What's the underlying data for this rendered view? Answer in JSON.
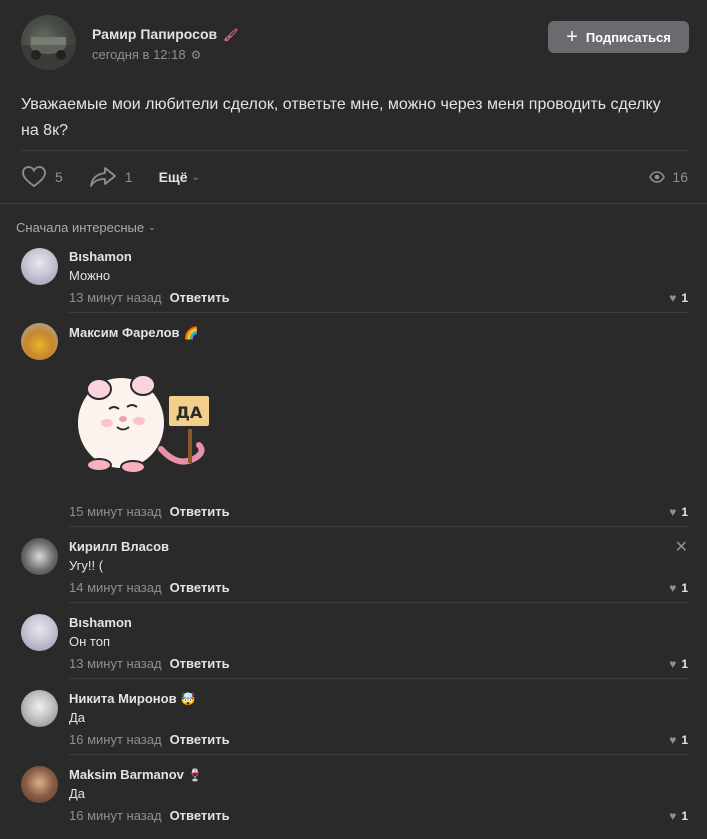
{
  "post": {
    "author": "Рамир Папиросов",
    "author_emoji": "🖌",
    "time": "сегодня в 12:18",
    "subscribe_label": "Подписаться",
    "text": "Уважаемые мои любители сделок, ответьте мне, можно через меня проводить сделку на 8к?",
    "likes": "5",
    "shares": "1",
    "more_label": "Ещё",
    "views": "16"
  },
  "comments_header": {
    "sort_label": "Сначала интересные"
  },
  "comments": [
    {
      "author": "Bıshamon",
      "emoji": "",
      "text": "Можно",
      "time": "13 минут назад",
      "reply": "Ответить",
      "likes": "1"
    },
    {
      "author": "Максим Фарелов",
      "emoji": "🌈",
      "text": "",
      "sticker_text": "ДА",
      "time": "15 минут назад",
      "reply": "Ответить",
      "likes": "1"
    },
    {
      "author": "Кирилл Власов",
      "emoji": "",
      "text": "Угу!! (",
      "time": "14 минут назад",
      "reply": "Ответить",
      "likes": "1"
    },
    {
      "author": "Bıshamon",
      "emoji": "",
      "text": "Он топ",
      "time": "13 минут назад",
      "reply": "Ответить",
      "likes": "1"
    },
    {
      "author": "Никита Миронов",
      "emoji": "🤯",
      "text": "Да",
      "time": "16 минут назад",
      "reply": "Ответить",
      "likes": "1"
    },
    {
      "author": "Maksim Barmanov",
      "emoji": "🍷",
      "text": "Да",
      "time": "16 минут назад",
      "reply": "Ответить",
      "likes": "1"
    }
  ],
  "colors": {
    "background": "#2a2a2b",
    "text": "#e1e3e6",
    "muted": "#8d8f93",
    "button": "#6a6b6e"
  }
}
